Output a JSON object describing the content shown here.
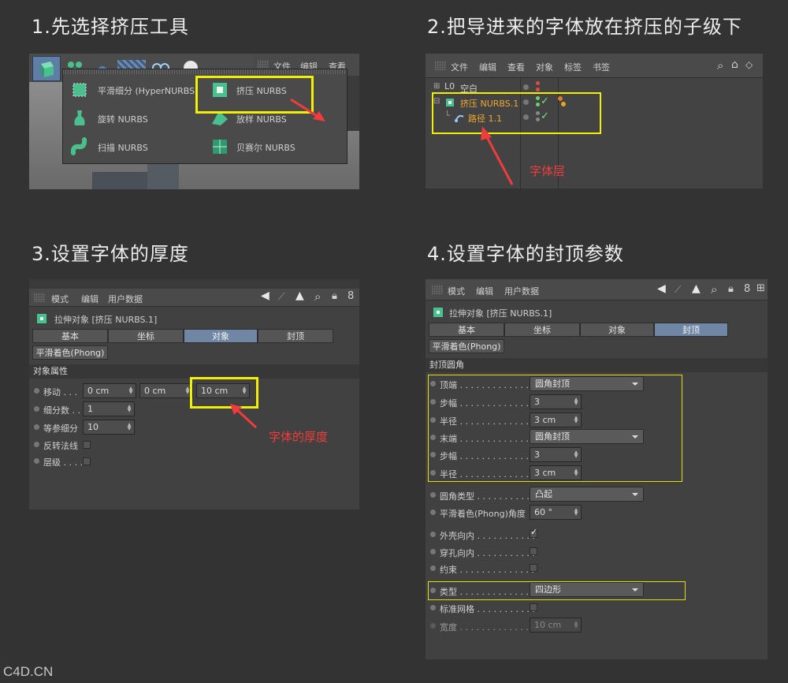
{
  "titles": {
    "s1": "1.先选择挤压工具",
    "s2": "2.把导进来的字体放在挤压的子级下",
    "s3": "3.设置字体的厚度",
    "s4": "4.设置字体的封顶参数"
  },
  "watermark": "C4D.CN",
  "p1": {
    "menu": [
      "文件",
      "编辑",
      "查看"
    ],
    "items": {
      "hyper": "平滑细分 (HyperNURBS)",
      "extrude": "挤压 NURBS",
      "lathe": "旋转 NURBS",
      "loft": "放样 NURBS",
      "sweep": "扫描 NURBS",
      "bezier": "贝赛尔 NURBS"
    }
  },
  "p2": {
    "menu": [
      "文件",
      "编辑",
      "查看",
      "对象",
      "标签",
      "书签"
    ],
    "null_obj": "空白",
    "extrude_obj": "挤压 NURBS.1",
    "path_obj": "路径 1.1",
    "annotation": "字体层"
  },
  "p3": {
    "menu": [
      "模式",
      "编辑",
      "用户数据"
    ],
    "object_title": "拉伸对象 [挤压 NURBS.1]",
    "tabs": [
      "基本",
      "坐标",
      "对象",
      "封顶"
    ],
    "phong_tab": "平滑着色(Phong)",
    "section": "对象属性",
    "move_label": "移动 . . .",
    "move_x": "0 cm",
    "move_y": "0 cm",
    "move_z": "10 cm",
    "subdiv_label": "细分数 . .",
    "subdiv_val": "1",
    "iso_label": "等参细分",
    "iso_val": "10",
    "flip_label": "反转法线",
    "hier_label": "层级 . . . .",
    "annotation": "字体的厚度"
  },
  "p4": {
    "menu": [
      "模式",
      "编辑",
      "用户数据"
    ],
    "object_title": "拉伸对象 [挤压 NURBS.1]",
    "tabs": [
      "基本",
      "坐标",
      "对象",
      "封顶"
    ],
    "phong_tab": "平滑着色(Phong)",
    "section": "封顶圆角",
    "top_label": "顶端 . . . . . . . . . . . . . .",
    "top_val": "圆角封顶",
    "steps1_label": "步幅 . . . . . . . . . . . . . .",
    "steps1_val": "3",
    "radius1_label": "半径 . . . . . . . . . . . . . .",
    "radius1_val": "3 cm",
    "end_label": "末端 . . . . . . . . . . . . . .",
    "end_val": "圆角封顶",
    "steps2_label": "步幅 . . . . . . . . . . . . . .",
    "steps2_val": "3",
    "radius2_label": "半径 . . . . . . . . . . . . . .",
    "radius2_val": "3 cm",
    "filletType_label": "圆角类型 . . . . . . . . . . .",
    "filletType_val": "凸起",
    "phongAngle_label": "平滑着色(Phong)角度",
    "phongAngle_val": "60 °",
    "hullInward_label": "外壳向内 . . . . . . . . . . .",
    "holeInward_label": "穿孔向内 . . . . . . . . . . .",
    "constrain_label": "约束 . . . . . . . . . . . . . .",
    "type_label": "类型 . . . . . . . . . . . . . .",
    "type_val": "四边形",
    "regularGrid_label": "标准网格 . . . . . . . . . . .",
    "width_label": "宽度 . . . . . . . . . . . . . .",
    "width_val": "10 cm"
  }
}
